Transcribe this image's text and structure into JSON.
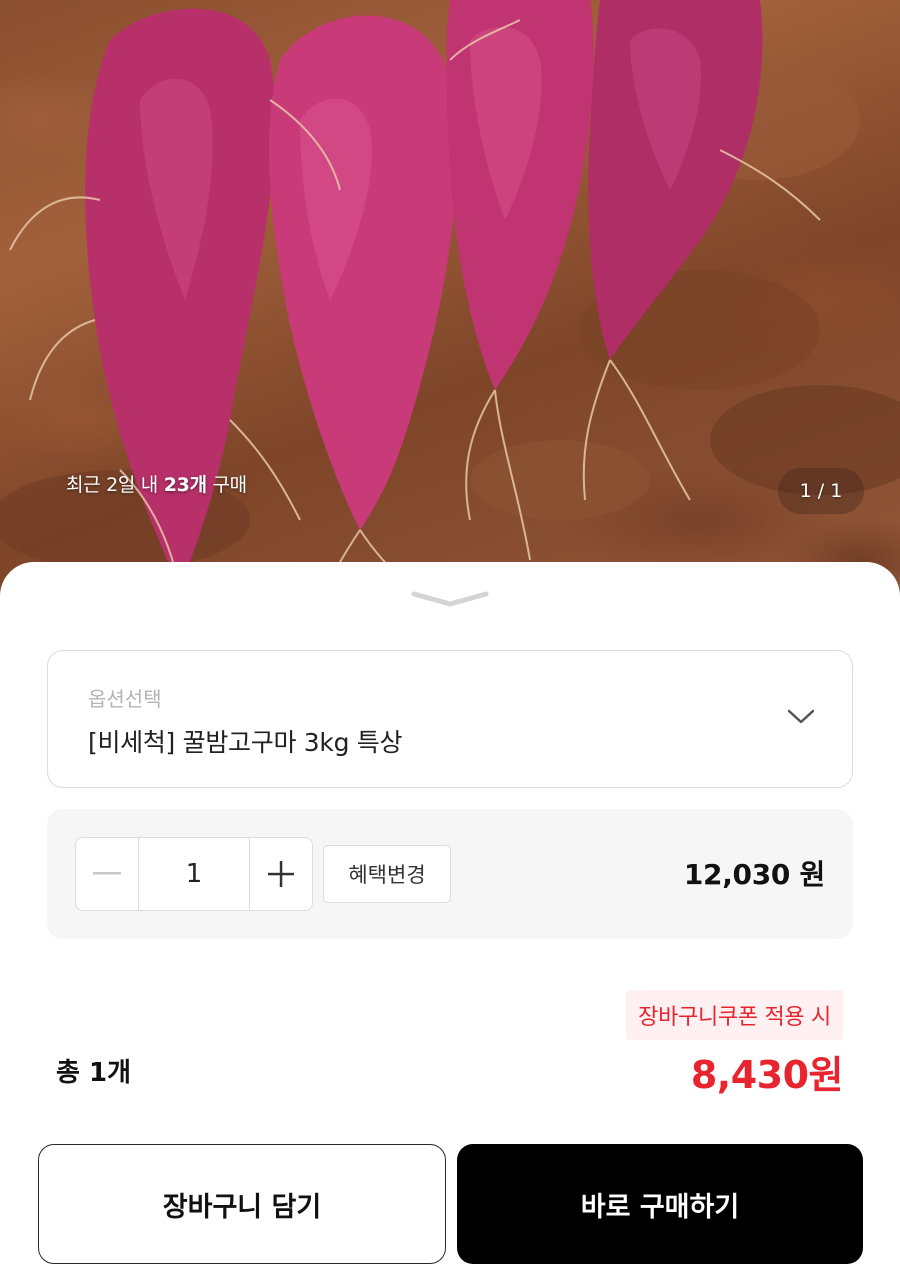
{
  "photo": {
    "purchase_prefix": "최근 2일 내 ",
    "purchase_count": "23개",
    "purchase_suffix": " 구매",
    "page_indicator": "1 / 1"
  },
  "option": {
    "label": "옵션선택",
    "selected": "[비세척] 꿀밤고구마 3kg 특상"
  },
  "quantity": {
    "value": "1",
    "benefit_label": "혜택변경",
    "line_price": "12,030 원"
  },
  "summary": {
    "coupon_note": "장바구니쿠폰 적용 시",
    "total_count": "총 1개",
    "total_price": "8,430원"
  },
  "actions": {
    "cart_label": "장바구니 담기",
    "buy_label": "바로 구매하기"
  },
  "colors": {
    "accent_red": "#e8242f",
    "buy_button": "#000000",
    "coupon_bg": "#fff1f2"
  }
}
